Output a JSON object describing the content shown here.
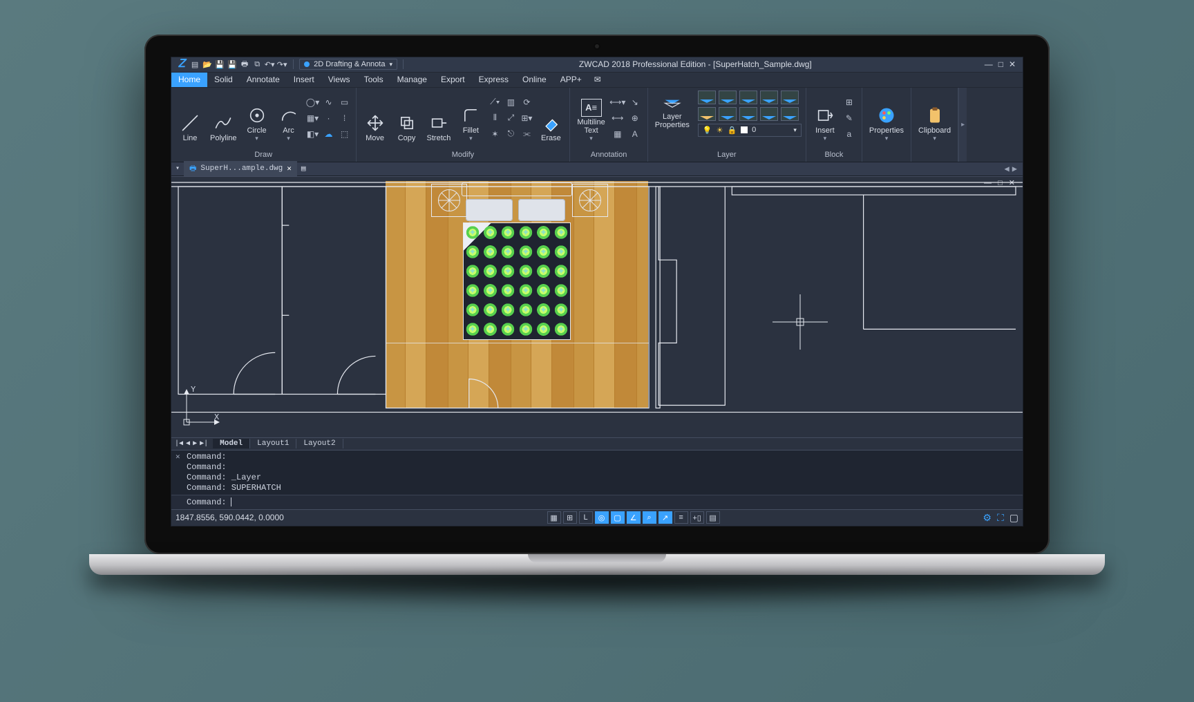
{
  "qat": {
    "workspace": "2D Drafting & Annota"
  },
  "title": "ZWCAD 2018 Professional Edition - [SuperHatch_Sample.dwg]",
  "tabs": [
    "Home",
    "Solid",
    "Annotate",
    "Insert",
    "Views",
    "Tools",
    "Manage",
    "Export",
    "Express",
    "Online",
    "APP+"
  ],
  "active_tab": "Home",
  "ribbon": {
    "draw": {
      "label": "Draw",
      "buttons": {
        "line": "Line",
        "polyline": "Polyline",
        "circle": "Circle",
        "arc": "Arc"
      }
    },
    "modify": {
      "label": "Modify",
      "buttons": {
        "move": "Move",
        "copy": "Copy",
        "stretch": "Stretch",
        "fillet": "Fillet",
        "erase": "Erase"
      }
    },
    "annotation": {
      "label": "Annotation",
      "buttons": {
        "mtext": "Multiline\nText"
      }
    },
    "layer": {
      "label": "Layer",
      "buttons": {
        "layerprops": "Layer\nProperties"
      },
      "current": "0"
    },
    "block": {
      "label": "Block",
      "buttons": {
        "insert": "Insert"
      }
    },
    "props": {
      "label": "Properties"
    },
    "clip": {
      "label": "Clipboard"
    }
  },
  "doc_tab": "SuperH...ample.dwg",
  "ucs": {
    "x": "X",
    "y": "Y"
  },
  "layout_tabs": {
    "model": "Model",
    "l1": "Layout1",
    "l2": "Layout2"
  },
  "cmd": {
    "hist": [
      "Command:",
      "Command:",
      "Command: _Layer",
      "Command: SUPERHATCH"
    ],
    "prompt": "Command:"
  },
  "status": {
    "coords": "1847.8556, 590.0442, 0.0000",
    "toggles": [
      "grid",
      "grid2",
      "ruler",
      "snap",
      "rect",
      "angle",
      "endpoint",
      "arrow",
      "lines",
      "scale",
      "thick"
    ],
    "toggles_on": [
      3,
      4,
      5,
      6,
      7
    ]
  }
}
